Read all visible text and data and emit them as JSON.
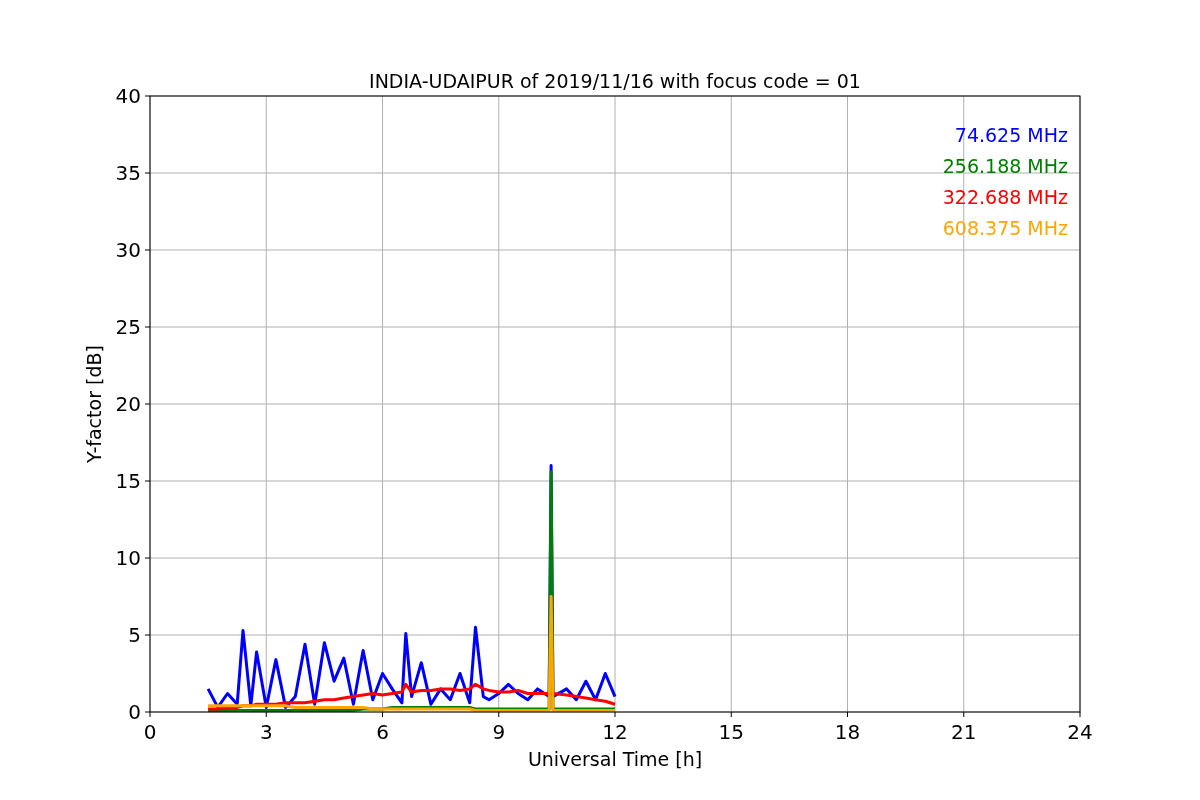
{
  "chart_data": {
    "type": "line",
    "title": "INDIA-UDAIPUR of 2019/11/16 with focus code = 01",
    "xlabel": "Universal Time [h]",
    "ylabel": "Y-factor [dB]",
    "x": [
      1.5,
      1.75,
      2,
      2.25,
      2.4,
      2.6,
      2.75,
      3,
      3.25,
      3.5,
      3.75,
      4,
      4.25,
      4.5,
      4.75,
      5,
      5.25,
      5.5,
      5.75,
      6,
      6.25,
      6.5,
      6.6,
      6.75,
      7,
      7.25,
      7.5,
      7.75,
      8,
      8.25,
      8.4,
      8.6,
      8.75,
      9,
      9.25,
      9.5,
      9.75,
      10,
      10.3,
      10.35,
      10.4,
      10.75,
      11,
      11.25,
      11.5,
      11.75,
      12
    ],
    "series": [
      {
        "name": "74.625 MHz",
        "color": "#0000ff",
        "values": [
          1.5,
          0.3,
          1.2,
          0.5,
          5.3,
          0.4,
          3.9,
          0.3,
          3.4,
          0.3,
          1.0,
          4.4,
          0.5,
          4.5,
          2.0,
          3.5,
          0.5,
          4.0,
          0.8,
          2.5,
          1.5,
          0.6,
          5.1,
          1.0,
          3.2,
          0.5,
          1.5,
          0.8,
          2.5,
          0.6,
          5.5,
          1.0,
          0.8,
          1.2,
          1.8,
          1.2,
          0.8,
          1.5,
          1.0,
          16.0,
          1.0,
          1.5,
          0.8,
          2.0,
          0.8,
          2.5,
          1.0
        ]
      },
      {
        "name": "256.188 MHz",
        "color": "#008000",
        "values": [
          0.1,
          0.1,
          0.1,
          0.1,
          0.1,
          0.1,
          0.1,
          0.1,
          0.1,
          0.1,
          0.1,
          0.1,
          0.1,
          0.1,
          0.1,
          0.1,
          0.1,
          0.2,
          0.2,
          0.2,
          0.3,
          0.3,
          0.3,
          0.3,
          0.3,
          0.3,
          0.3,
          0.3,
          0.3,
          0.3,
          0.2,
          0.2,
          0.2,
          0.2,
          0.2,
          0.2,
          0.2,
          0.2,
          0.2,
          15.6,
          0.2,
          0.2,
          0.2,
          0.2,
          0.2,
          0.2,
          0.2
        ]
      },
      {
        "name": "322.688 MHz",
        "color": "#ff0000",
        "values": [
          0.2,
          0.2,
          0.3,
          0.3,
          0.4,
          0.4,
          0.5,
          0.5,
          0.5,
          0.6,
          0.6,
          0.6,
          0.7,
          0.8,
          0.8,
          0.9,
          1.0,
          1.1,
          1.2,
          1.1,
          1.2,
          1.3,
          1.8,
          1.3,
          1.4,
          1.4,
          1.5,
          1.5,
          1.4,
          1.5,
          1.8,
          1.5,
          1.4,
          1.3,
          1.3,
          1.4,
          1.2,
          1.2,
          1.2,
          1.2,
          1.2,
          1.1,
          1.0,
          0.9,
          0.8,
          0.7,
          0.5
        ]
      },
      {
        "name": "608.375 MHz",
        "color": "#ffa500",
        "values": [
          0.4,
          0.4,
          0.4,
          0.4,
          0.4,
          0.4,
          0.4,
          0.4,
          0.4,
          0.4,
          0.3,
          0.3,
          0.3,
          0.3,
          0.3,
          0.3,
          0.3,
          0.3,
          0.2,
          0.2,
          0.2,
          0.2,
          0.2,
          0.2,
          0.2,
          0.2,
          0.2,
          0.2,
          0.2,
          0.2,
          0.1,
          0.1,
          0.1,
          0.1,
          0.1,
          0.1,
          0.1,
          0.1,
          0.1,
          7.5,
          0.1,
          0.1,
          0.1,
          0.1,
          0.1,
          0.1,
          0.1
        ]
      }
    ],
    "xlim": [
      0,
      24
    ],
    "ylim": [
      0,
      40
    ],
    "xticks": [
      0,
      3,
      6,
      9,
      12,
      15,
      18,
      21,
      24
    ],
    "yticks": [
      0,
      5,
      10,
      15,
      20,
      25,
      30,
      35,
      40
    ],
    "grid": true
  }
}
